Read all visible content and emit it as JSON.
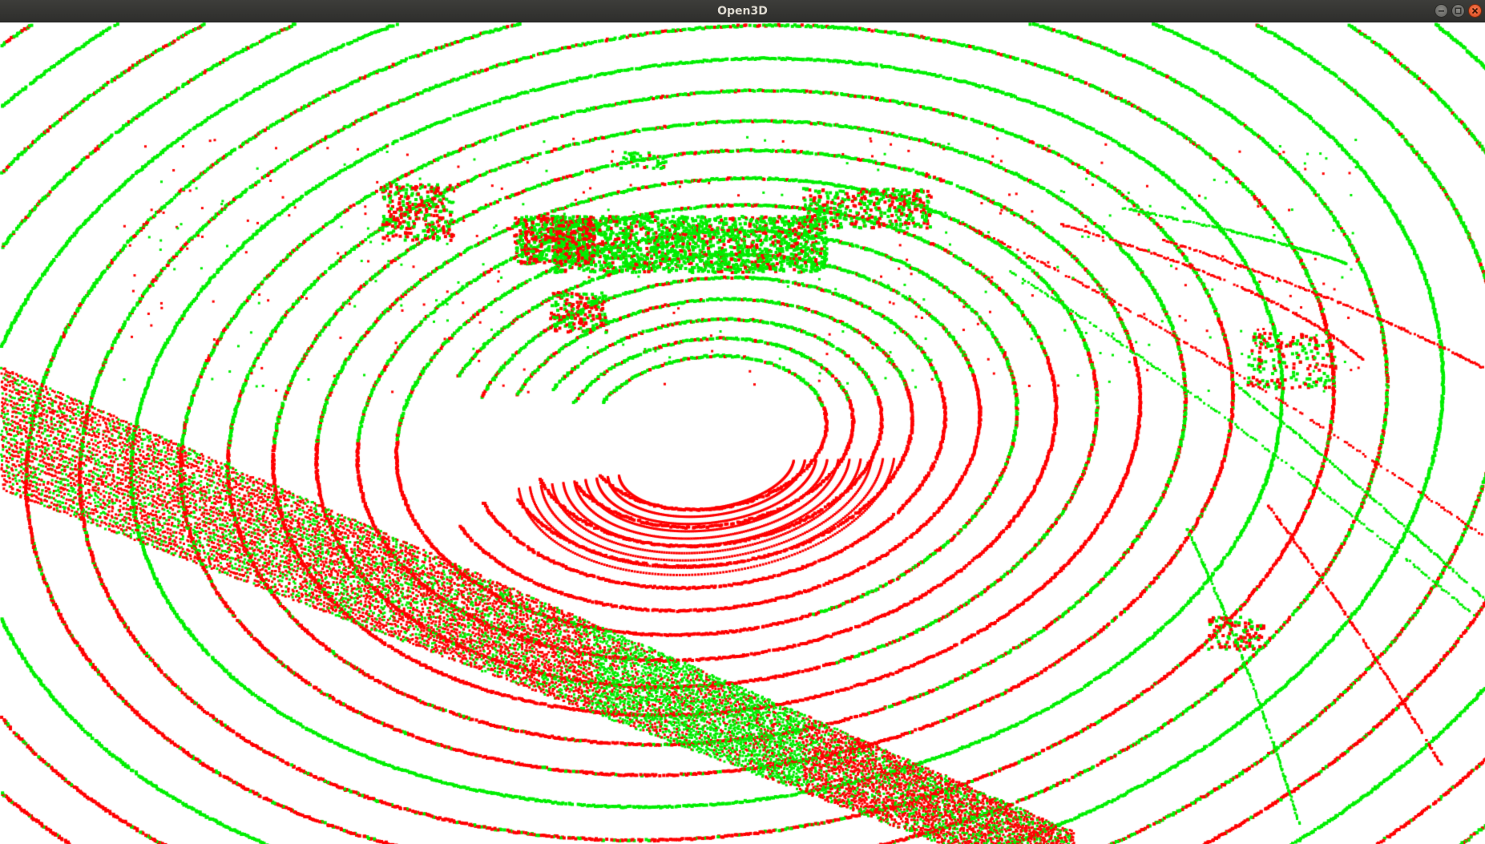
{
  "window": {
    "title": "Open3D"
  },
  "colors": {
    "titlebar": "#2e2e2c",
    "title_text": "#dfdbd2",
    "background": "#ffffff",
    "point_red": "#ff0000",
    "point_green": "#00ee00",
    "close_button": "#e0521f"
  },
  "icons": {
    "minimize": "minimize-icon",
    "maximize": "maximize-icon",
    "close": "close-icon"
  }
}
